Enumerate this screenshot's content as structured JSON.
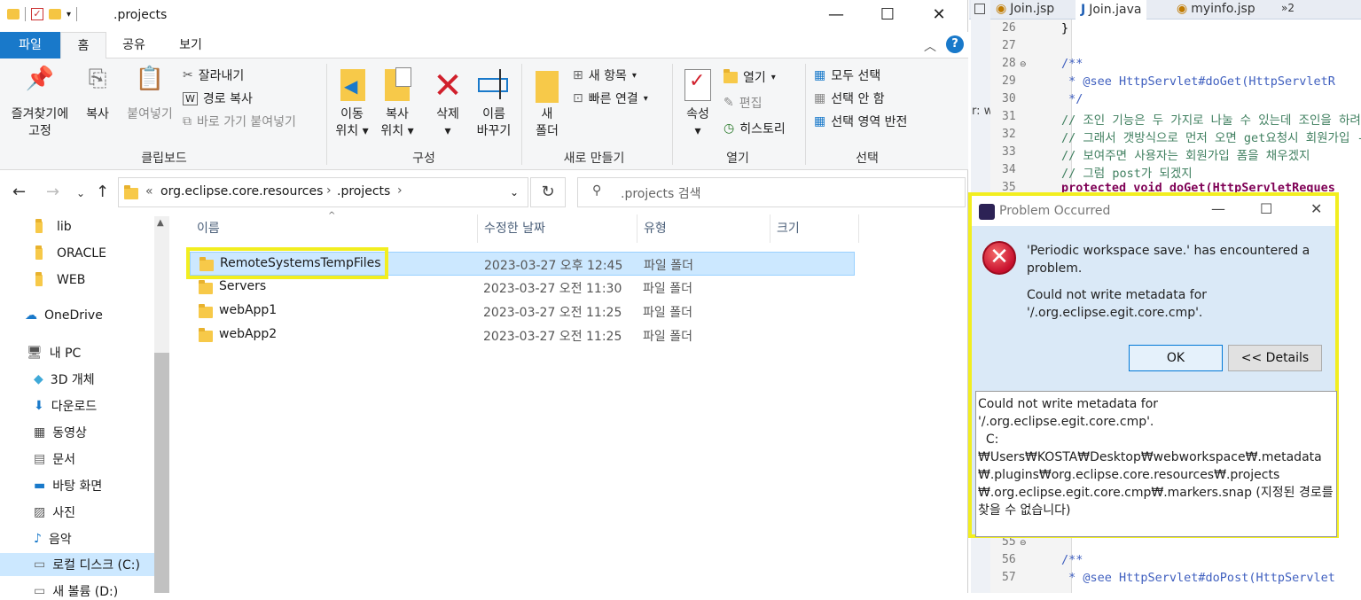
{
  "explorer": {
    "window_title": ".projects",
    "ribbon_tabs": {
      "file": "파일",
      "home": "홈",
      "share": "공유",
      "view": "보기"
    },
    "clipboard": {
      "label": "클립보드",
      "pin_line1": "즐겨찾기에",
      "pin_line2": "고정",
      "copy": "복사",
      "paste": "붙여넣기",
      "cut": "잘라내기",
      "copy_path": "경로 복사",
      "paste_shortcut": "바로 가기 붙여넣기"
    },
    "organize": {
      "label": "구성",
      "move_line1": "이동",
      "move_line2": "위치",
      "copyto_line1": "복사",
      "copyto_line2": "위치",
      "delete": "삭제",
      "rename_line1": "이름",
      "rename_line2": "바꾸기"
    },
    "new": {
      "label": "새로 만들기",
      "folder_line1": "새",
      "folder_line2": "폴더",
      "new_item": "새 항목",
      "easy_access": "빠른 연결"
    },
    "open": {
      "label": "열기",
      "properties": "속성",
      "open": "열기",
      "edit": "편집",
      "history": "히스토리"
    },
    "select": {
      "label": "선택",
      "select_all": "모두 선택",
      "select_none": "선택 안 함",
      "invert": "선택 영역 반전"
    },
    "address": {
      "overflow": "«",
      "crumb1": "org.eclipse.core.resources",
      "crumb2": ".projects"
    },
    "search_placeholder": ".projects 검색",
    "nav": {
      "items": [
        "lib",
        "ORACLE",
        "WEB",
        "OneDrive",
        "내 PC",
        "3D 개체",
        "다운로드",
        "동영상",
        "문서",
        "바탕 화면",
        "사진",
        "음악",
        "로컬 디스크 (C:)",
        "새 볼륨 (D:)"
      ]
    },
    "columns": {
      "name": "이름",
      "modified": "수정한 날짜",
      "type": "유형",
      "size": "크기"
    },
    "files": [
      {
        "name": "RemoteSystemsTempFiles",
        "modified": "2023-03-27 오후 12:45",
        "type": "파일 폴더"
      },
      {
        "name": "Servers",
        "modified": "2023-03-27 오전 11:30",
        "type": "파일 폴더"
      },
      {
        "name": "webApp1",
        "modified": "2023-03-27 오전 11:25",
        "type": "파일 폴더"
      },
      {
        "name": "webApp2",
        "modified": "2023-03-27 오전 11:25",
        "type": "파일 폴더"
      }
    ]
  },
  "eclipse": {
    "tabs": [
      "Join.jsp",
      "Join.java",
      "myinfo.jsp",
      "»2"
    ],
    "side_text": "r: w",
    "lines": [
      {
        "n": "26",
        "code": "}"
      },
      {
        "n": "27",
        "code": ""
      },
      {
        "n": "28",
        "code": "/**"
      },
      {
        "n": "29",
        "code": " * @see HttpServlet#doGet(HttpServletR"
      },
      {
        "n": "30",
        "code": " */"
      },
      {
        "n": "31",
        "code": "// 조인 기능은 두 가지로 나눌 수 있는데 조인을 하려"
      },
      {
        "n": "32",
        "code": "// 그래서 갯방식으로 먼저 오면 get요청시 회원가입 -"
      },
      {
        "n": "33",
        "code": "// 보여주면 사용자는 회원가입 폼을 채우겠지"
      },
      {
        "n": "34",
        "code": "// 그럼 post가 되겠지"
      },
      {
        "n": "35",
        "code": "protected void doGet(HttpServletReques"
      },
      {
        "n": "55",
        "code": ""
      },
      {
        "n": "56",
        "code": "/**"
      },
      {
        "n": "57",
        "code": " * @see HttpServlet#doPost(HttpServlet"
      }
    ]
  },
  "dialog": {
    "title": "Problem Occurred",
    "message1": "'Periodic workspace save.' has encountered a problem.",
    "message2": "Could not write metadata for '/.org.eclipse.egit.core.cmp'.",
    "ok": "OK",
    "details": "<< Details",
    "details_text": "Could not write metadata for '/.org.eclipse.egit.core.cmp'.\n  C:₩Users₩KOSTA₩Desktop₩webworkspace₩.metadata\n₩.plugins₩org.eclipse.core.resources₩.projects\n₩.org.eclipse.egit.core.cmp₩.markers.snap (지정된 경로를 찾을 수 없습니다)"
  }
}
